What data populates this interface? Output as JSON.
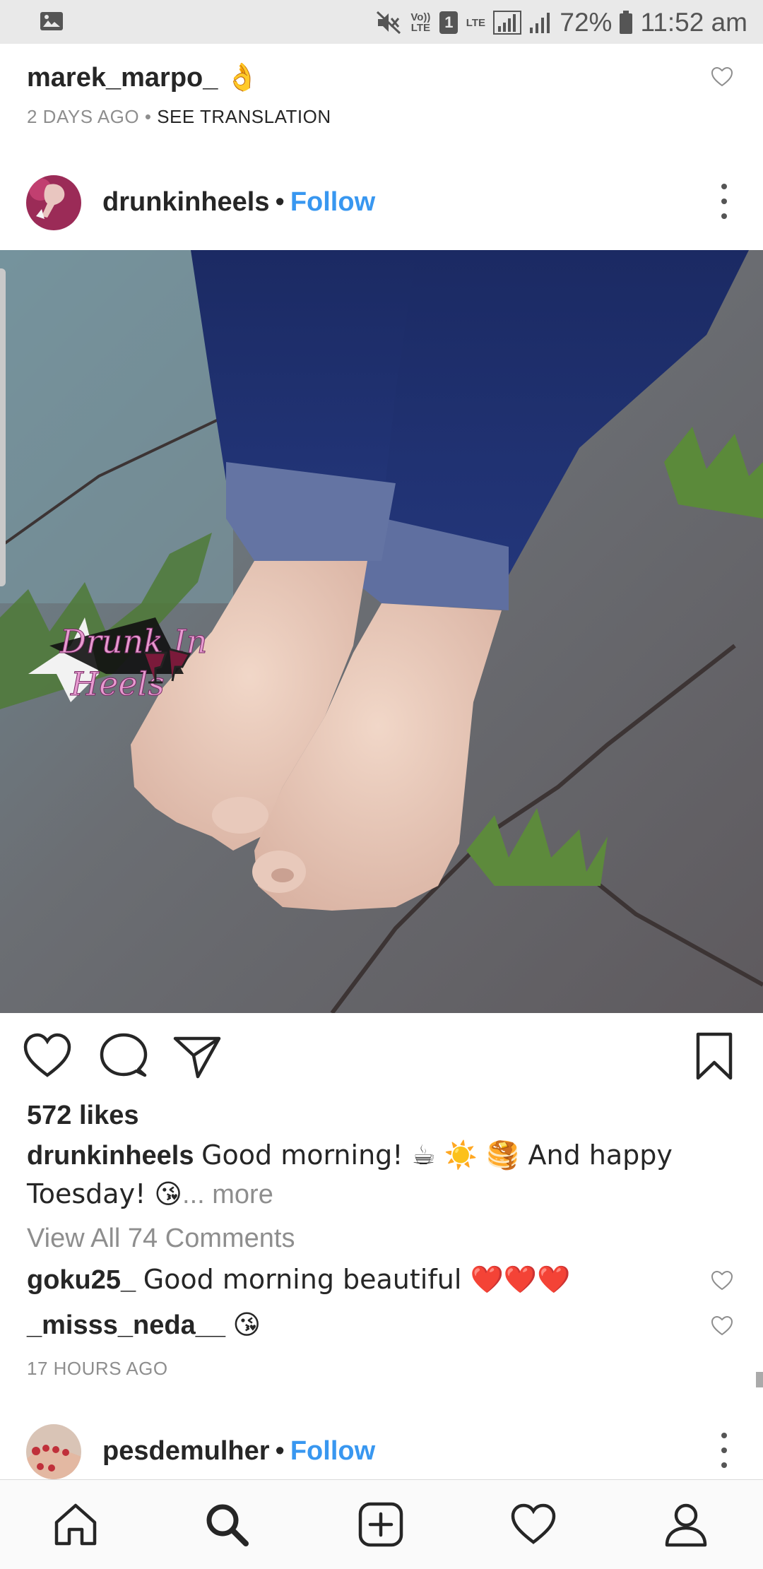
{
  "status_bar": {
    "volte_label": "Vo)) LTE",
    "sim_label": "1",
    "network_label": "LTE",
    "battery": "72%",
    "time": "11:52 am"
  },
  "top_comment": {
    "username": "marek_marpo_",
    "text": "👌",
    "age": "2 DAYS AGO",
    "separator": "•",
    "translate": "SEE TRANSLATION"
  },
  "post": {
    "username": "drunkinheels",
    "separator": "•",
    "follow_label": "Follow",
    "image_watermark": [
      "Drunk In",
      "Heels"
    ],
    "likes": "572 likes",
    "caption": {
      "username": "drunkinheels",
      "text": "Good morning! ☕ ☀️ 🥞 And happy Toesday! 😘",
      "more": "... more"
    },
    "view_all_comments": "View All 74 Comments",
    "comments": [
      {
        "username": "goku25_",
        "text": "Good morning beautiful ❤️❤️❤️"
      },
      {
        "username": "_misss_neda__",
        "text": "😘"
      }
    ],
    "time": "17 HOURS AGO"
  },
  "next_post": {
    "username": "pesdemulher",
    "separator": "•",
    "follow_label": "Follow"
  },
  "bottom_nav": [
    "home-icon",
    "search-icon",
    "add-post-icon",
    "activity-heart-icon",
    "profile-icon"
  ],
  "colors": {
    "link_blue": "#3897f0",
    "muted": "#8e8e8e",
    "text": "#262626"
  }
}
